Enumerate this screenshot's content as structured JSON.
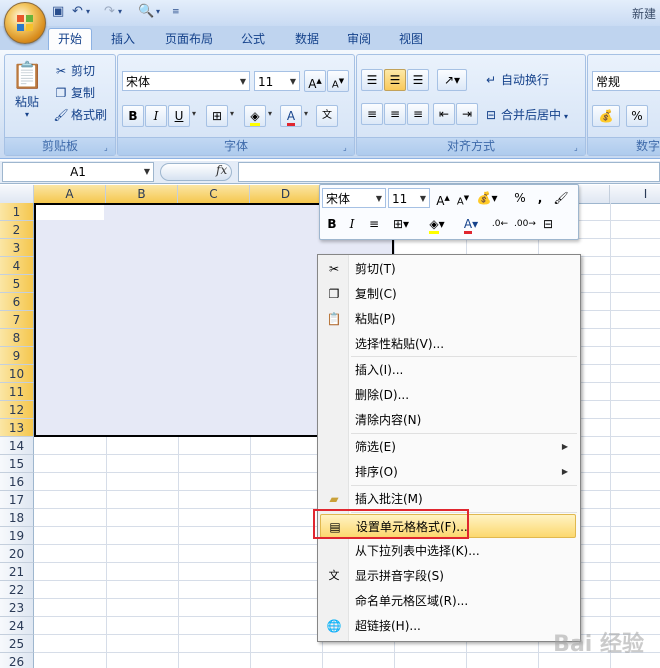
{
  "titlebar": {
    "title": "新建"
  },
  "tabs": [
    "开始",
    "插入",
    "页面布局",
    "公式",
    "数据",
    "审阅",
    "视图"
  ],
  "clipboard": {
    "paste": "粘贴",
    "cut": "剪切",
    "copy": "复制",
    "format_painter": "格式刷",
    "group": "剪贴板"
  },
  "font": {
    "name": "宋体",
    "size": "11",
    "group": "字体",
    "bold": "B",
    "italic": "I",
    "underline": "U"
  },
  "alignment": {
    "wrap": "自动换行",
    "merge": "合并后居中",
    "group": "对齐方式"
  },
  "number": {
    "format": "常规",
    "group": "数字",
    "percent": "%"
  },
  "formula": {
    "namebox": "A1",
    "fx": "fx"
  },
  "columns": [
    "A",
    "B",
    "C",
    "D",
    "I"
  ],
  "rows": [
    "1",
    "2",
    "3",
    "4",
    "5",
    "6",
    "7",
    "8",
    "9",
    "10",
    "11",
    "12",
    "13",
    "14",
    "15",
    "16",
    "17",
    "18",
    "19",
    "20",
    "21",
    "22",
    "23",
    "24",
    "25",
    "26"
  ],
  "minibar": {
    "font": "宋体",
    "size": "11",
    "percent": "%",
    "comma": ","
  },
  "context_menu": [
    {
      "label": "剪切(T)",
      "icon": "scissors-icon"
    },
    {
      "label": "复制(C)",
      "icon": "copy-icon"
    },
    {
      "label": "粘贴(P)",
      "icon": "paste-icon"
    },
    {
      "label": "选择性粘贴(V)...",
      "icon": ""
    },
    {
      "label": "插入(I)...",
      "icon": ""
    },
    {
      "label": "删除(D)...",
      "icon": ""
    },
    {
      "label": "清除内容(N)",
      "icon": ""
    },
    {
      "label": "筛选(E)",
      "icon": ""
    },
    {
      "label": "排序(O)",
      "icon": ""
    },
    {
      "label": "插入批注(M)",
      "icon": "comment-icon"
    },
    {
      "label": "设置单元格格式(F)...",
      "icon": "format-cells-icon"
    },
    {
      "label": "从下拉列表中选择(K)...",
      "icon": ""
    },
    {
      "label": "显示拼音字段(S)",
      "icon": "phonetic-icon"
    },
    {
      "label": "命名单元格区域(R)...",
      "icon": ""
    },
    {
      "label": "超链接(H)...",
      "icon": "hyperlink-icon"
    }
  ],
  "watermark": "Bai 经验",
  "colors": {
    "highlight": "#fcd86e",
    "selection": "#e6e9f6",
    "accent_red": "#e0262f"
  }
}
